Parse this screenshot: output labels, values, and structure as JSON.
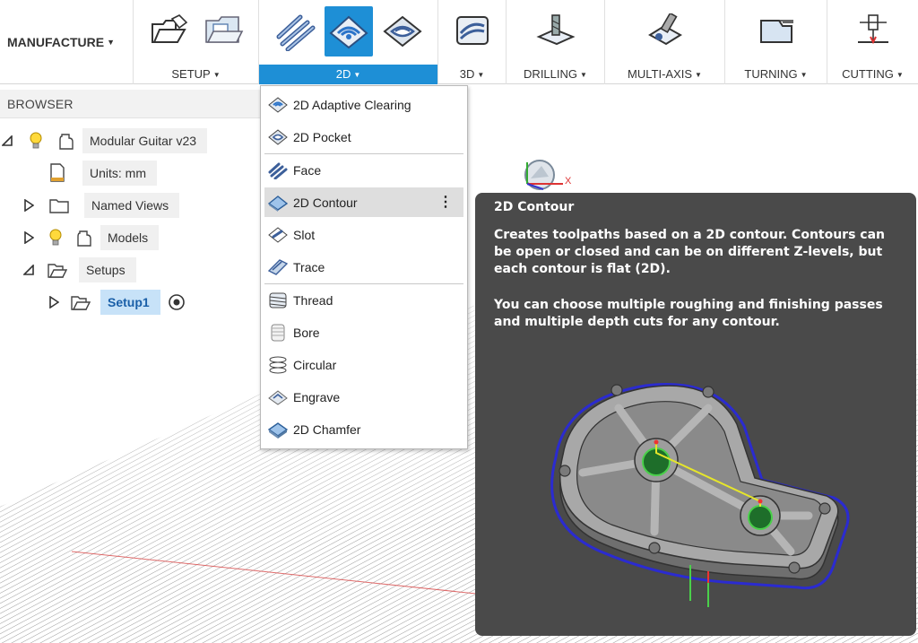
{
  "toolbar": {
    "workspace": "MANUFACTURE",
    "groups": [
      {
        "id": "setup",
        "label": "SETUP"
      },
      {
        "id": "2d",
        "label": "2D"
      },
      {
        "id": "3d",
        "label": "3D"
      },
      {
        "id": "drilling",
        "label": "DRILLING"
      },
      {
        "id": "multiaxis",
        "label": "MULTI-AXIS"
      },
      {
        "id": "turning",
        "label": "TURNING"
      },
      {
        "id": "cutting",
        "label": "CUTTING"
      }
    ],
    "accent": "#1e8fd6"
  },
  "browser": {
    "title": "BROWSER",
    "root": "Modular Guitar v23",
    "units": "Units: mm",
    "named_views": "Named Views",
    "models": "Models",
    "setups": "Setups",
    "setup1": "Setup1"
  },
  "menu": {
    "items": [
      {
        "label": "2D Adaptive Clearing",
        "icon": "adaptive-clearing-icon"
      },
      {
        "label": "2D Pocket",
        "icon": "pocket-icon"
      },
      {
        "label": "Face",
        "icon": "face-icon"
      },
      {
        "label": "2D Contour",
        "icon": "contour-icon"
      },
      {
        "label": "Slot",
        "icon": "slot-icon"
      },
      {
        "label": "Trace",
        "icon": "trace-icon"
      },
      {
        "label": "Thread",
        "icon": "thread-icon"
      },
      {
        "label": "Bore",
        "icon": "bore-icon"
      },
      {
        "label": "Circular",
        "icon": "circular-icon"
      },
      {
        "label": "Engrave",
        "icon": "engrave-icon"
      },
      {
        "label": "2D Chamfer",
        "icon": "chamfer-icon"
      }
    ],
    "hovered": "2D Contour",
    "more_glyph": "⋮"
  },
  "tooltip": {
    "title": "2D Contour",
    "paragraph1": "Creates toolpaths based on a 2D contour. Contours can be open or closed and can be on different Z-levels, but each contour is flat (2D).",
    "paragraph2": "You can choose multiple roughing and finishing passes and multiple depth cuts for any contour."
  },
  "viewcube": {
    "axis_x": "X"
  }
}
